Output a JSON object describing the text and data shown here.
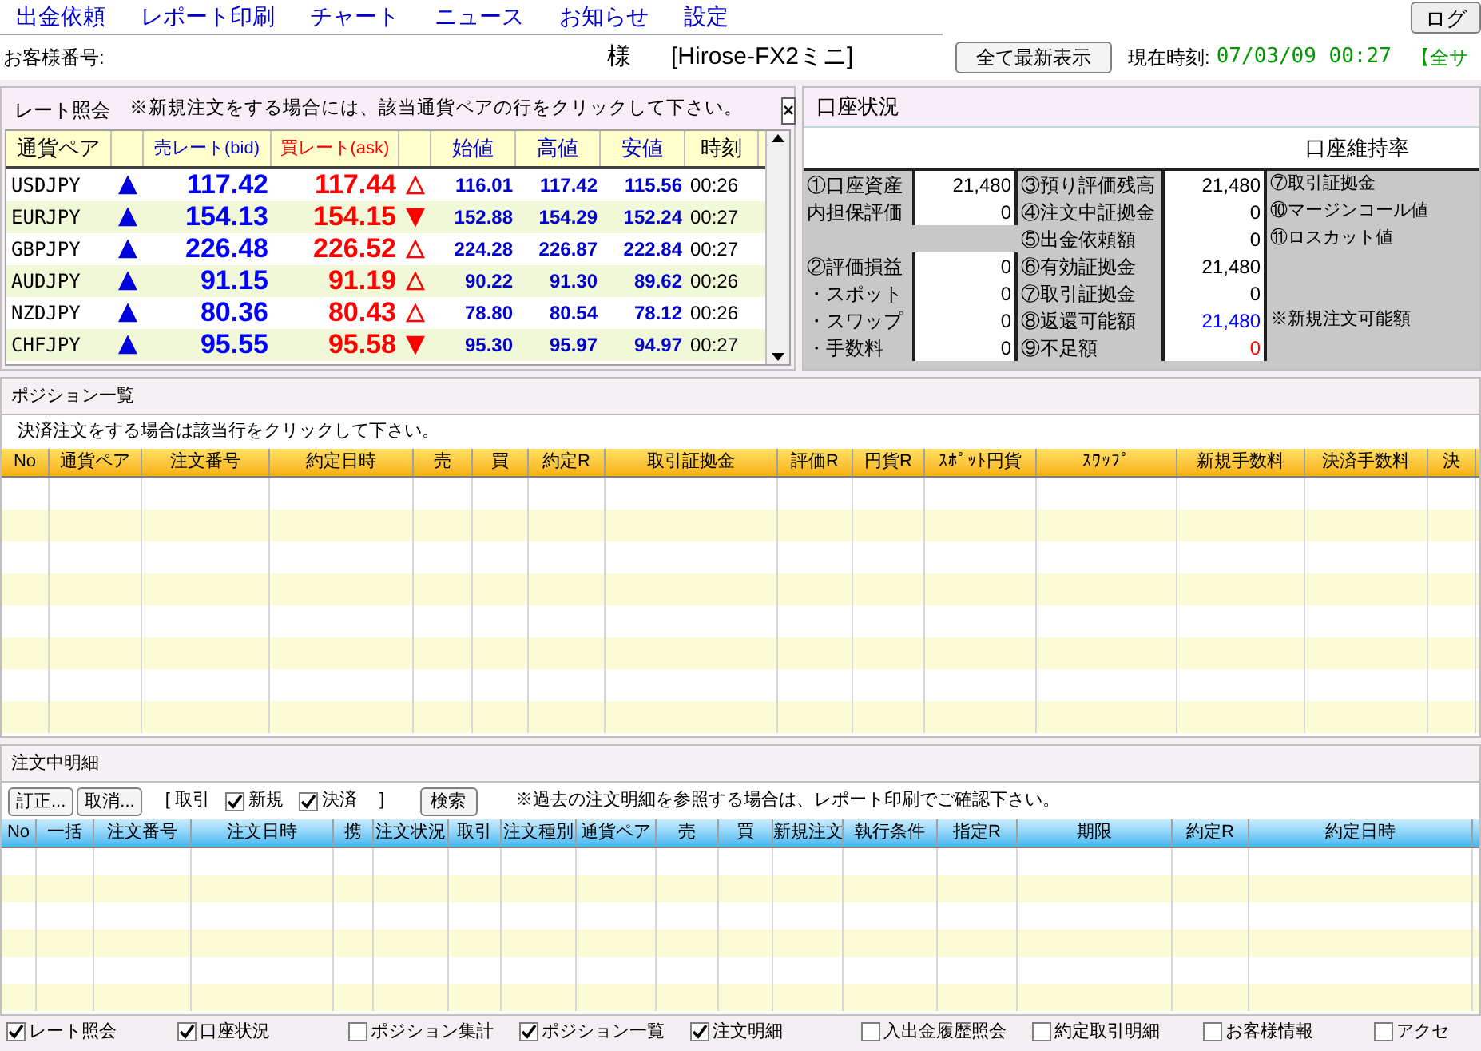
{
  "menu": [
    {
      "label": "出金依頼"
    },
    {
      "label": "レポート印刷"
    },
    {
      "label": "チャート"
    },
    {
      "label": "ニュース"
    },
    {
      "label": "お知らせ"
    },
    {
      "label": "設定"
    }
  ],
  "logout_button": "ログ",
  "customer": {
    "label": "お客様番号:",
    "honorific": "様",
    "account_type": "[Hirose-FX2ミニ]"
  },
  "refresh_button": "全て最新表示",
  "clock": {
    "label": "現在時刻:",
    "value": "07/03/09 00:27"
  },
  "status_notice": "【全サ",
  "rate_panel": {
    "title": "レート照会",
    "hint": "※新規注文をする場合には、該当通貨ペアの行をクリックして下さい。",
    "close": "×",
    "columns": [
      "通貨ペア",
      "売レート(bid)",
      "買レート(ask)",
      "始値",
      "高値",
      "安値",
      "時刻"
    ],
    "rows": [
      {
        "pair": "USDJPY",
        "bid_up": true,
        "bid": "117.42",
        "ask": "117.44",
        "ask_up": true,
        "open": "116.01",
        "high": "117.42",
        "low": "115.56",
        "time": "00:26"
      },
      {
        "pair": "EURJPY",
        "bid_up": true,
        "bid": "154.13",
        "ask": "154.15",
        "ask_up": false,
        "open": "152.88",
        "high": "154.29",
        "low": "152.24",
        "time": "00:27"
      },
      {
        "pair": "GBPJPY",
        "bid_up": true,
        "bid": "226.48",
        "ask": "226.52",
        "ask_up": true,
        "open": "224.28",
        "high": "226.87",
        "low": "222.84",
        "time": "00:27"
      },
      {
        "pair": "AUDJPY",
        "bid_up": true,
        "bid": "91.15",
        "ask": "91.19",
        "ask_up": true,
        "open": "90.22",
        "high": "91.30",
        "low": "89.62",
        "time": "00:26"
      },
      {
        "pair": "NZDJPY",
        "bid_up": true,
        "bid": "80.36",
        "ask": "80.43",
        "ask_up": true,
        "open": "78.80",
        "high": "80.54",
        "low": "78.12",
        "time": "00:26"
      },
      {
        "pair": "CHFJPY",
        "bid_up": true,
        "bid": "95.55",
        "ask": "95.58",
        "ask_up": false,
        "open": "95.30",
        "high": "95.97",
        "low": "94.97",
        "time": "00:27"
      }
    ]
  },
  "account_panel": {
    "title": "口座状況",
    "maintenance_label": "口座維持率",
    "columns": [
      [
        {
          "kind": "entry",
          "label": "①口座資産",
          "value": "21,480",
          "color": "#000000"
        },
        {
          "kind": "entry",
          "label": "内担保評価",
          "value": "0",
          "color": "#000000"
        },
        {
          "kind": "spacer"
        },
        {
          "kind": "entry",
          "label": "②評価損益",
          "value": "0",
          "color": "#000000"
        },
        {
          "kind": "entry",
          "label": "・スポット",
          "value": "0",
          "color": "#000000"
        },
        {
          "kind": "entry",
          "label": "・スワップ",
          "value": "0",
          "color": "#000000"
        },
        {
          "kind": "entry",
          "label": "・手数料",
          "value": "0",
          "color": "#000000"
        }
      ],
      [
        {
          "kind": "entry",
          "label": "③預り評価残高",
          "value": "21,480",
          "color": "#000000"
        },
        {
          "kind": "entry",
          "label": "④注文中証拠金",
          "value": "0",
          "color": "#000000"
        },
        {
          "kind": "entry",
          "label": "⑤出金依頼額",
          "value": "0",
          "color": "#000000"
        },
        {
          "kind": "entry",
          "label": "⑥有効証拠金",
          "value": "21,480",
          "color": "#000000"
        },
        {
          "kind": "entry",
          "label": "⑦取引証拠金",
          "value": "0",
          "color": "#000000"
        },
        {
          "kind": "entry",
          "label": "⑧返還可能額",
          "value": "21,480",
          "color": "#0000ff"
        },
        {
          "kind": "entry",
          "label": "⑨不足額",
          "value": "0",
          "color": "#ff0000"
        }
      ],
      [
        {
          "kind": "label",
          "label": "⑦取引証拠金"
        },
        {
          "kind": "label",
          "label": "⑩マージンコール値"
        },
        {
          "kind": "label",
          "label": "⑪ロスカット値"
        },
        {
          "kind": "spacer"
        },
        {
          "kind": "spacer"
        },
        {
          "kind": "label",
          "label": "※新規注文可能額"
        },
        {
          "kind": "spacer"
        }
      ]
    ]
  },
  "positions": {
    "title": "ポジション一覧",
    "hint": "決済注文をする場合は該当行をクリックして下さい。",
    "columns": [
      "No",
      "通貨ペア",
      "注文番号",
      "約定日時",
      "売",
      "買",
      "約定R",
      "取引証拠金",
      "評価R",
      "円貨R",
      "ｽﾎﾟｯﾄ円貨",
      "ｽﾜｯﾌﾟ",
      "新規手数料",
      "決済手数料",
      "決"
    ]
  },
  "orders": {
    "title": "注文中明細",
    "buttons": [
      "訂正...",
      "取消..."
    ],
    "filter_open": "[ 取引",
    "filters": [
      {
        "label": "新規",
        "checked": true
      },
      {
        "label": "決済",
        "checked": true
      }
    ],
    "filter_close": "]",
    "search_button": "検索",
    "note": "※過去の注文明細を参照する場合は、レポート印刷でご確認下さい。",
    "columns": [
      "No",
      "一括",
      "注文番号",
      "注文日時",
      "携",
      "注文状況",
      "取引",
      "注文種別",
      "通貨ペア",
      "売",
      "買",
      "新規注文",
      "執行条件",
      "指定R",
      "期限",
      "約定R",
      "約定日時"
    ]
  },
  "panel_toggles": [
    {
      "label": "レート照会",
      "checked": true
    },
    {
      "label": "口座状況",
      "checked": true
    },
    {
      "label": "ポジション集計",
      "checked": false
    },
    {
      "label": "ポジション一覧",
      "checked": true
    },
    {
      "label": "注文明細",
      "checked": true
    },
    {
      "label": "入出金履歴照会",
      "checked": false
    },
    {
      "label": "約定取引明細",
      "checked": false
    },
    {
      "label": "お客様情報",
      "checked": false
    },
    {
      "label": "アクセ",
      "checked": false
    }
  ]
}
